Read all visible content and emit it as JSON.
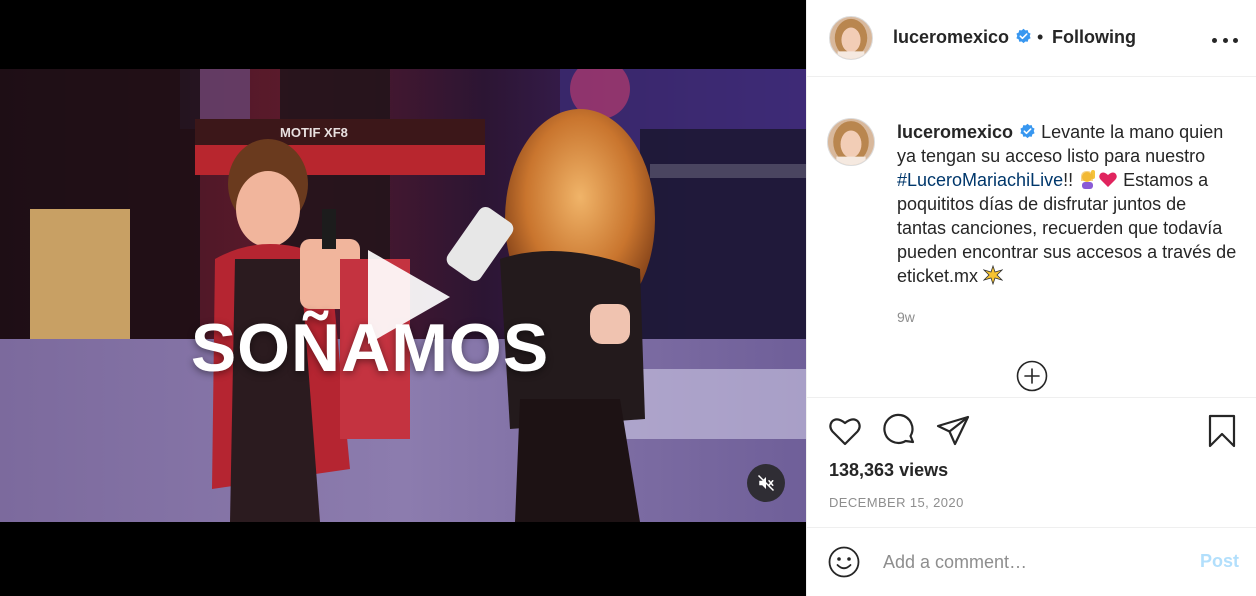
{
  "video": {
    "overlay_text": "SOÑAMOS",
    "keyboard_label": "MOTIF XF8"
  },
  "header": {
    "username": "luceromexico",
    "separator": "•",
    "follow_status": "Following"
  },
  "caption": {
    "username": "luceromexico",
    "text_before_hashtag": "Levante la mano quien ya tengan su acceso listo para nuestro ",
    "hashtag": "#LuceroMariachiLive",
    "text_after_hashtag": "!! ",
    "text_second": " Estamos a poquititos días de disfrutar juntos de tantas canciones, recuerden que todavía pueden encontrar sus accesos a través de eticket.mx ",
    "time_ago": "9w"
  },
  "stats": {
    "views": "138,363 views",
    "date": "DECEMBER 15, 2020"
  },
  "comment": {
    "placeholder": "Add a comment…",
    "post_label": "Post"
  },
  "icons": {
    "play": "play-icon",
    "mute": "speaker-muted-icon",
    "verified": "verified-badge-icon",
    "more": "more-options-icon",
    "load_more": "plus-circle-icon",
    "like": "heart-icon",
    "comment": "comment-bubble-icon",
    "share": "paper-plane-icon",
    "save": "bookmark-icon",
    "emoji": "smiley-icon"
  },
  "colors": {
    "verified": "#3897f0",
    "hashtag": "#00376b",
    "post_disabled": "#b2dffc",
    "secondary_text": "#8e8e8e",
    "divider": "#efefef"
  }
}
